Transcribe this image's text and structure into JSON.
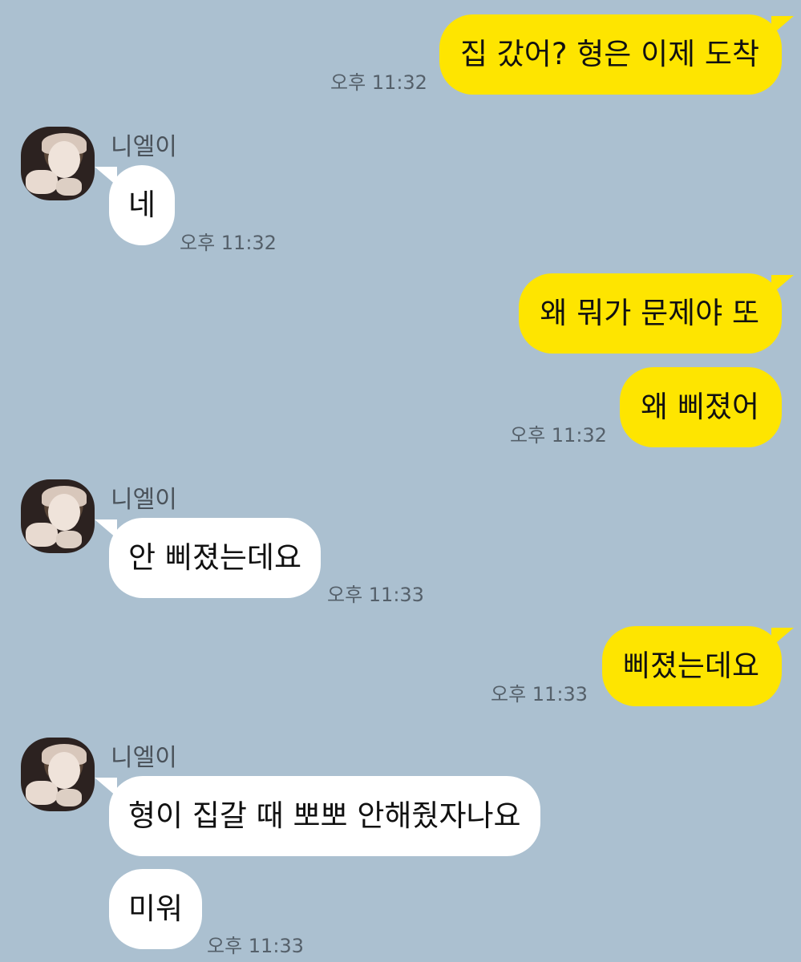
{
  "contact": {
    "name": "니엘이"
  },
  "messages": [
    {
      "text": "집 갔어? 형은 이제 도착",
      "time": "오후 11:32"
    },
    {
      "text": "네",
      "time": "오후 11:32"
    },
    {
      "text": "왜 뭐가 문제야 또"
    },
    {
      "text": "왜 삐졌어",
      "time": "오후 11:32"
    },
    {
      "text": "안 삐졌는데요",
      "time": "오후 11:33"
    },
    {
      "text": "삐졌는데요",
      "time": "오후 11:33"
    },
    {
      "text": "형이 집갈 때 뽀뽀 안해줬자나요"
    },
    {
      "text": "미워",
      "time": "오후 11:33"
    }
  ],
  "colors": {
    "background": "#abc0d0",
    "outgoing_bubble": "#fee500",
    "incoming_bubble": "#ffffff",
    "timestamp": "#55606a"
  }
}
